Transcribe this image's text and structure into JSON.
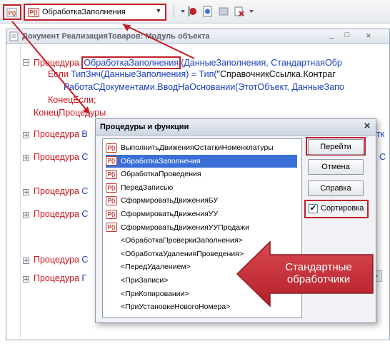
{
  "toolbar": {
    "dropdown_value": "ОбработкаЗаполнения",
    "dropdown_badge": "P()"
  },
  "module": {
    "title": "Документ РеализацияТоваров: Модуль объекта",
    "code": {
      "line1_kw": "Процедура",
      "line1_name": "ОбработкаЗаполнения",
      "line1_rest": "(ДанныеЗаполнения, СтандартнаяОбр",
      "line2_kw1": "Если",
      "line2_fn1": "ТипЗнч(ДанныеЗаполнения)",
      "line2_eq": "=",
      "line2_fn2": "Тип(",
      "line2_str": "\"СправочникСсылка.Контраг",
      "line3": "РаботаСДокументами.ВводНаОсновании(ЭтотОбъект, ДанныеЗапо",
      "line4": "КонецЕсли;",
      "line5": "КонецПроцедуры",
      "collapsed_kw": "Процедура",
      "collapsed_partial": [
        "В",
        "С",
        "С",
        "С",
        "С",
        "Г"
      ],
      "tail_partial": [
        "тк",
        "С"
      ]
    }
  },
  "dialog": {
    "title": "Процедуры и функции",
    "close_glyph": "×",
    "items": [
      {
        "badge": "P()",
        "label": "ВыполнитьДвиженияОстаткиНоменклатуры",
        "selected": false
      },
      {
        "badge": "P()",
        "label": "ОбработкаЗаполнения",
        "selected": true
      },
      {
        "badge": "P()",
        "label": "ОбработкаПроведения",
        "selected": false
      },
      {
        "badge": "P()",
        "label": "ПередЗаписью",
        "selected": false
      },
      {
        "badge": "P()",
        "label": "СформироватьДвиженияБУ",
        "selected": false
      },
      {
        "badge": "P()",
        "label": "СформироватьДвиженияУУ",
        "selected": false
      },
      {
        "badge": "P()",
        "label": "СформироватьДвиженияУУПродажи",
        "selected": false
      },
      {
        "badge": "",
        "label": "<ОбработкаПроверкиЗаполнения>",
        "selected": false
      },
      {
        "badge": "",
        "label": "<ОбработкаУдаленияПроведения>",
        "selected": false
      },
      {
        "badge": "",
        "label": "<ПередУдалением>",
        "selected": false
      },
      {
        "badge": "",
        "label": "<ПриЗаписи>",
        "selected": false
      },
      {
        "badge": "",
        "label": "<ПриКопировании>",
        "selected": false
      },
      {
        "badge": "",
        "label": "<ПриУстановкеНовогоНомера>",
        "selected": false
      }
    ],
    "buttons": {
      "go": "Перейти",
      "cancel": "Отмена",
      "help": "Справка"
    },
    "sort_label": "Сортировка",
    "sort_checked": true
  },
  "callout": {
    "line1": "Стандартные",
    "line2": "обработчики"
  },
  "colors": {
    "annotation_red": "#c0202a",
    "selection_blue": "#3a6fd8",
    "keyword_red": "#d0141e",
    "identifier_blue": "#1c3fbf"
  }
}
